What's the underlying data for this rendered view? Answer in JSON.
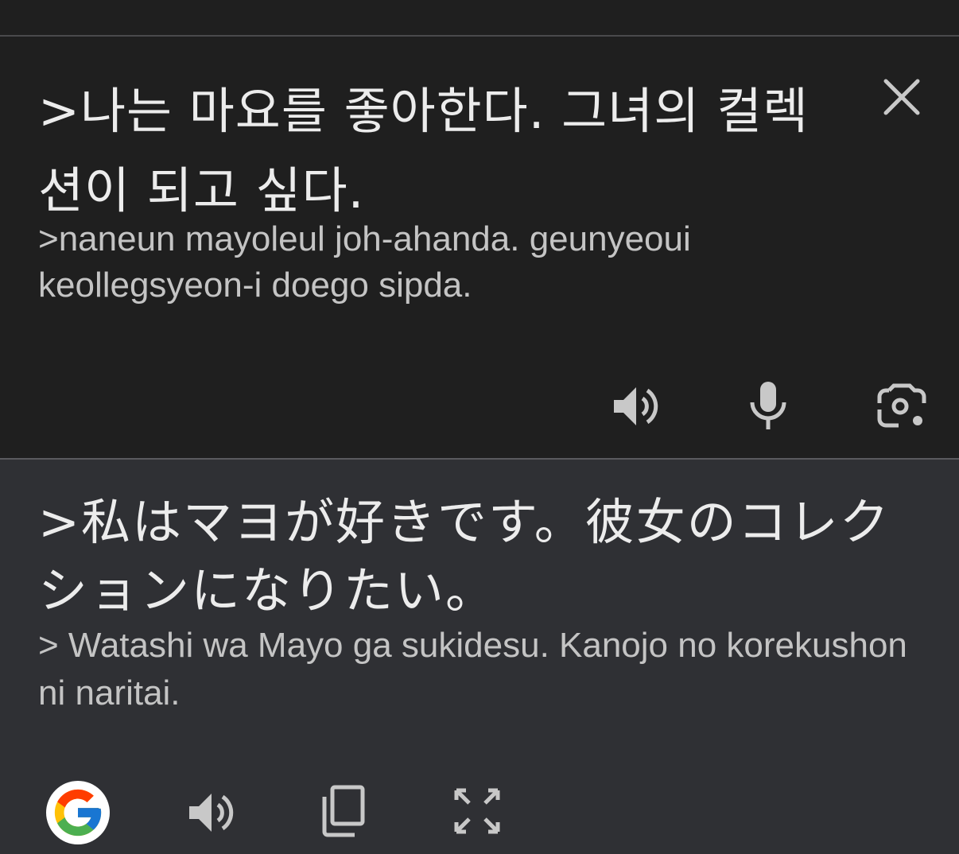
{
  "source": {
    "text": ">나는 마요를 좋아한다. 그녀의 컬렉션이 되고 싶다.",
    "romanization": ">naneun mayoleul joh-ahanda. geunyeoui keollegsyeon-i doego sipda."
  },
  "target": {
    "text": ">私はマヨが好きです。彼女のコレクションになりたい。",
    "romanization": "> Watashi wa Mayo ga sukidesu. Kanojo no korekushon ni naritai."
  },
  "icons": {
    "close": "close-icon",
    "speaker": "speaker-icon",
    "microphone": "microphone-icon",
    "camera": "camera-translate-icon",
    "google": "google-icon",
    "copy": "copy-icon",
    "fullscreen": "fullscreen-icon"
  },
  "colors": {
    "source_bg": "#1f1f1f",
    "target_bg": "#2f3034",
    "text_primary": "#ececec",
    "text_secondary": "#c4c4c4",
    "icon": "#c8c8c8"
  }
}
